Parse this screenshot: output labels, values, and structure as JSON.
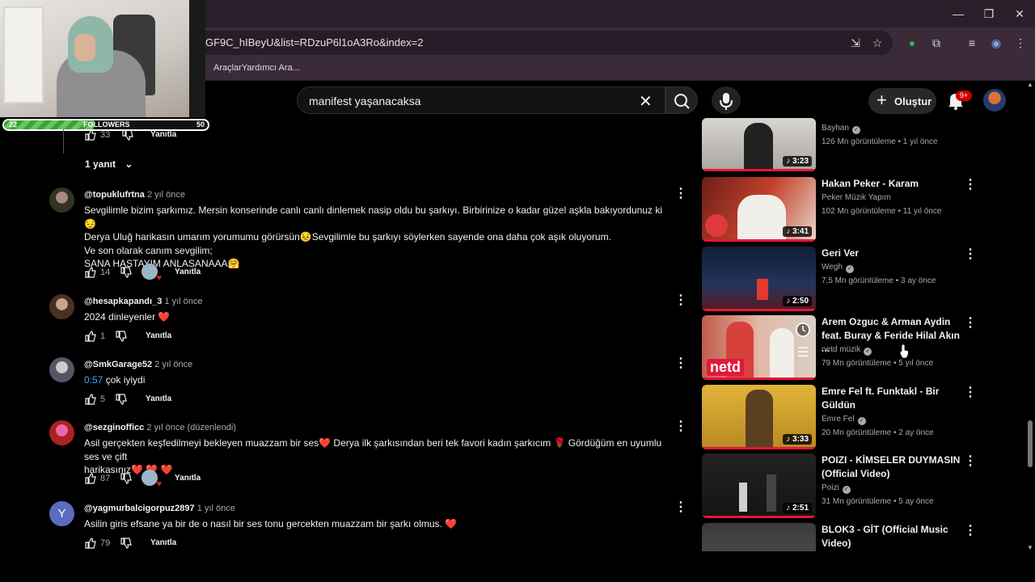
{
  "browser": {
    "url": "GF9C_hIBeyU&list=RDzuP6l1oA3Ro&index=2",
    "bookmark": "AraçlarYardımcı Ara...",
    "window_controls": [
      "minimize-icon",
      "maximize-icon",
      "close-icon"
    ]
  },
  "overlay": {
    "followers_label": "FOLLOWERS",
    "followers_current": "22",
    "followers_goal": "50",
    "followers_progress": 0.44
  },
  "masthead": {
    "search_value": "manifest yaşanacaksa",
    "create_label": "Oluştur",
    "notifications_badge": "9+"
  },
  "comments": {
    "prev": {
      "likes": "33",
      "reply_label": "Yanıtla"
    },
    "replies_toggle": "1 yanıt",
    "items": [
      {
        "author": "@topuklufrtna",
        "time": "2 yıl önce",
        "lines": [
          "Sevgilimle bizim şarkımız. Mersin konserinde canlı canlı dinlemek nasip oldu bu şarkıyı. Birbirinize o kadar güzel aşkla bakıyordunuz ki 😔",
          "Derya Uluğ harikasın umarım yorumumu görürsün😣Sevgilimle bu şarkıyı söylerken sayende ona daha çok aşık oluyorum.",
          "Ve son olarak canım sevgilim;",
          "SANA HASTAYIM ANLASANAAA🤗"
        ],
        "likes": "14",
        "reply_label": "Yanıtla"
      },
      {
        "author": "@hesapkapandı_3",
        "time": "1 yıl önce",
        "lines": [
          "2024 dinleyenler ❤️"
        ],
        "likes": "1",
        "reply_label": "Yanıtla"
      },
      {
        "author": "@SmkGarage52",
        "time": "2 yıl önce",
        "timestamp": "0:57",
        "lines": [
          " çok iyiydi"
        ],
        "likes": "5",
        "reply_label": "Yanıtla"
      },
      {
        "author": "@sezginofficc",
        "time": "2 yıl önce (düzenlendi)",
        "lines": [
          "Asil gerçekten keşfedilmeyi bekleyen muazzam bir ses❤️  Derya ilk şarkısından beri tek favori kadın şarkıcım 🌹 Gördüğüm en uyumlu ses ve çift",
          "harikasınız❤️ ❤️ ❤️"
        ],
        "likes": "87",
        "reply_label": "Yanıtla"
      },
      {
        "author": "@yagmurbalcigorpuz2897",
        "time": "1 yıl önce",
        "avatar_letter": "Y",
        "lines": [
          "Asilin giris efsane ya bir de o nasıl bir ses tonu gercekten muazzam bir şarkı olmus. ❤️"
        ],
        "likes": "79",
        "reply_label": "Yanıtla"
      }
    ]
  },
  "sidebar": [
    {
      "title_lines": [],
      "channel": "Bayhan",
      "views": "126 Mn görüntüleme",
      "age": "1 yıl önce",
      "duration": "3:23",
      "thumb_color": "#c9c6c1"
    },
    {
      "title_lines": [
        "Hakan Peker - Karam"
      ],
      "channel": "Peker Müzik Yapım",
      "views": "102 Mn görüntüleme",
      "age": "11 yıl önce",
      "duration": "3:41",
      "thumb_color": "#b23a2b"
    },
    {
      "title_lines": [
        "Geri Ver"
      ],
      "channel": "Wegh",
      "views": "7,5 Mn görüntüleme",
      "age": "3 ay önce",
      "duration": "2:50",
      "thumb_color": "#1a2a4a"
    },
    {
      "title_lines": [
        "Arem Ozguc & Arman Aydin",
        "feat. Buray & Feride Hilal Akın ..."
      ],
      "channel": "netd müzik",
      "views": "79 Mn görüntüleme",
      "age": "5 yıl önce",
      "duration": "",
      "thumb_color": "#c98a7a",
      "logo": "netd"
    },
    {
      "title_lines": [
        "Emre Fel ft. Funktakl - Bir",
        "Güldün"
      ],
      "channel": "Emre Fel",
      "views": "20 Mn görüntüleme",
      "age": "2 ay önce",
      "duration": "3:33",
      "thumb_color": "#c9a030"
    },
    {
      "title_lines": [
        "POIZI - KİMSELER DUYMASIN",
        "(Official Video)"
      ],
      "channel": "Poizi",
      "views": "31 Mn görüntüleme",
      "age": "5 ay önce",
      "duration": "2:51",
      "thumb_color": "#1e1e20"
    },
    {
      "title_lines": [
        "BLOK3 - GİT (Official Music",
        "Video)"
      ],
      "channel": "",
      "views": "",
      "age": "",
      "duration": "",
      "thumb_color": "#2a2a2a"
    }
  ],
  "colors": {
    "accent": "#e3173b",
    "link": "#3ea6ff",
    "bg": "#0f0f0f"
  }
}
